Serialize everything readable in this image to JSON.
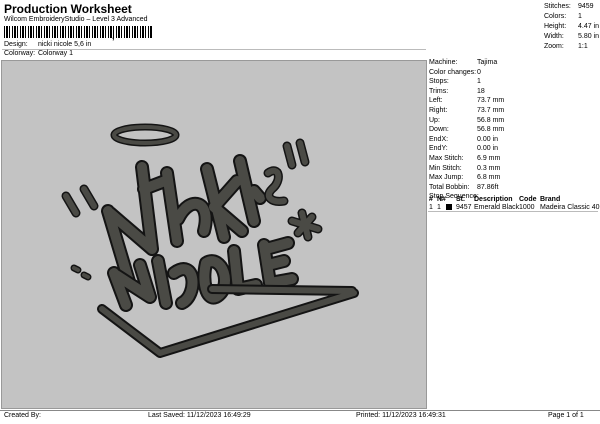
{
  "header": {
    "title": "Production Worksheet",
    "subtitle": "Wilcom EmbroideryStudio – Level 3 Advanced",
    "barcode_mark": ","
  },
  "design": {
    "design_label": "Design:",
    "design_value": "nicki nicole 5,6 in",
    "colorway_label": "Colorway:",
    "colorway_value": "Colorway 1"
  },
  "stats": [
    {
      "label": "Stitches:",
      "value": "9459"
    },
    {
      "label": "Colors:",
      "value": "1"
    },
    {
      "label": "Height:",
      "value": "4.47 in"
    },
    {
      "label": "Width:",
      "value": "5.80 in"
    },
    {
      "label": "Zoom:",
      "value": "1:1"
    }
  ],
  "info": [
    {
      "label": "Machine:",
      "value": "Tajima"
    },
    {
      "label": "Color changes:",
      "value": "0"
    },
    {
      "label": "Stops:",
      "value": "1"
    },
    {
      "label": "Trims:",
      "value": "18"
    },
    {
      "label": "Left:",
      "value": "73.7 mm"
    },
    {
      "label": "Right:",
      "value": "73.7 mm"
    },
    {
      "label": "Up:",
      "value": "56.8 mm"
    },
    {
      "label": "Down:",
      "value": "56.8 mm"
    },
    {
      "label": "EndX:",
      "value": "0.00 in"
    },
    {
      "label": "EndY:",
      "value": "0.00 in"
    },
    {
      "label": "Max Stitch:",
      "value": "6.9 mm"
    },
    {
      "label": "Min Stitch:",
      "value": "0.3 mm"
    },
    {
      "label": "Max Jump:",
      "value": "6.8 mm"
    },
    {
      "label": "Total Bobbin:",
      "value": "87.86ft"
    },
    {
      "label": "Stop Sequence:",
      "value": ""
    }
  ],
  "stop_sequence": {
    "headers": [
      "#",
      "N#",
      "St.",
      "Description",
      "Code",
      "Brand"
    ],
    "rows": [
      {
        "num": "1",
        "n": "1",
        "swatch_color": "#000000",
        "stitches": "9457",
        "description": "Emerald Black",
        "code": "1000",
        "brand": "Madeira Classic 40"
      }
    ]
  },
  "design_art": {
    "fill": "#4a4a45",
    "outline": "#141414",
    "canvas_bg": "#c3c3c3"
  },
  "footer": {
    "created_by": "Created By:",
    "last_saved": "Last Saved: 11/12/2023 16:49:29",
    "printed": "Printed: 11/12/2023 16:49:31",
    "page": "Page 1 of 1"
  }
}
